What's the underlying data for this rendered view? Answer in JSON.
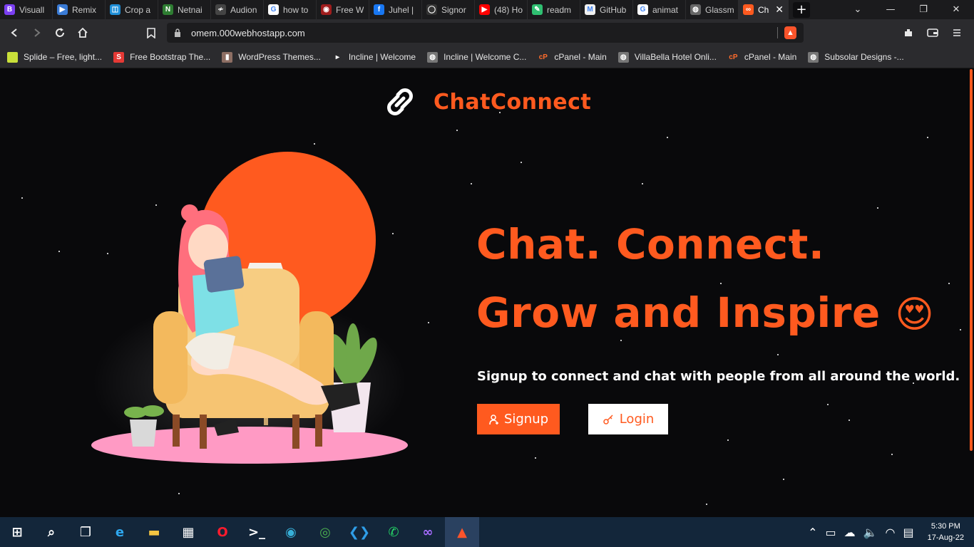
{
  "browser": {
    "tabs": [
      {
        "label": "Visuall",
        "icon": "letter-b-icon",
        "color": "#7b3ff2",
        "glyph": "B"
      },
      {
        "label": "Remix",
        "icon": "remix-icon",
        "color": "#3a7bd5",
        "glyph": "▶"
      },
      {
        "label": "Crop a",
        "icon": "crop-icon",
        "color": "#1f8fd8",
        "glyph": "◫"
      },
      {
        "label": "Netnai",
        "icon": "letter-n-icon",
        "color": "#2e7d32",
        "glyph": "N"
      },
      {
        "label": "Audion",
        "icon": "audio-icon",
        "color": "#444444",
        "glyph": "≁"
      },
      {
        "label": "how to",
        "icon": "google-icon",
        "color": "#ffffff",
        "glyph": "G"
      },
      {
        "label": "Free W",
        "icon": "free-icon",
        "color": "#a01d1d",
        "glyph": "◉"
      },
      {
        "label": "Juhel |",
        "icon": "facebook-icon",
        "color": "#1877f2",
        "glyph": "f"
      },
      {
        "label": "Signor",
        "icon": "github-icon",
        "color": "#333333",
        "glyph": "◯"
      },
      {
        "label": "(48) Ho",
        "icon": "youtube-icon",
        "color": "#ff0000",
        "glyph": "▶"
      },
      {
        "label": "readm",
        "icon": "readme-icon",
        "color": "#2fbf71",
        "glyph": "✎"
      },
      {
        "label": "GitHub",
        "icon": "github-page-icon",
        "color": "#f0f0f0",
        "glyph": "M"
      },
      {
        "label": "animat",
        "icon": "google-icon",
        "color": "#ffffff",
        "glyph": "G"
      },
      {
        "label": "Glassm",
        "icon": "globe-icon",
        "color": "#666666",
        "glyph": "◍"
      },
      {
        "label": "Ch",
        "icon": "chatconnect-icon",
        "color": "#ff5a1f",
        "glyph": "∞"
      }
    ],
    "url": "omem.000webhostapp.com",
    "bookmarks": [
      {
        "label": "Splide – Free, light...",
        "icon": "splide-icon",
        "color": "#c9e03a",
        "glyph": ""
      },
      {
        "label": "Free Bootstrap The...",
        "icon": "letter-s-icon",
        "color": "#e53935",
        "glyph": "S"
      },
      {
        "label": "WordPress Themes...",
        "icon": "wordpress-icon",
        "color": "#8d6e63",
        "glyph": "▮"
      },
      {
        "label": "Incline | Welcome",
        "icon": "incline-icon",
        "color": "#2b2b2e",
        "glyph": "▸"
      },
      {
        "label": "Incline | Welcome C...",
        "icon": "globe-icon",
        "color": "#777777",
        "glyph": "◍"
      },
      {
        "label": "cPanel - Main",
        "icon": "cpanel-icon",
        "color": "#2b2b2e",
        "glyph": "cP"
      },
      {
        "label": "VillaBella Hotel Onli...",
        "icon": "globe-icon",
        "color": "#777777",
        "glyph": "◍"
      },
      {
        "label": "cPanel - Main",
        "icon": "cpanel-icon",
        "color": "#2b2b2e",
        "glyph": "cP"
      },
      {
        "label": "Subsolar Designs -...",
        "icon": "globe-icon",
        "color": "#777777",
        "glyph": "◍"
      }
    ]
  },
  "page": {
    "brand": "ChatConnect",
    "headline_line1": "Chat. Connect.",
    "headline_line2": "Grow and Inspire",
    "headline_emoji": "😍",
    "subtitle": "Signup to connect and chat with people from all around the world.",
    "signup_label": "Signup",
    "login_label": "Login",
    "accent_color": "#ff5a1f"
  },
  "taskbar": {
    "apps": [
      "windows-start-icon",
      "search-icon",
      "task-view-icon",
      "edge-icon",
      "file-explorer-icon",
      "store-icon",
      "opera-icon",
      "terminal-icon",
      "app-icon",
      "chrome-icon",
      "vscode-icon",
      "whatsapp-icon",
      "visual-studio-icon",
      "brave-icon"
    ],
    "time": "5:30 PM",
    "date": "17-Aug-22"
  }
}
